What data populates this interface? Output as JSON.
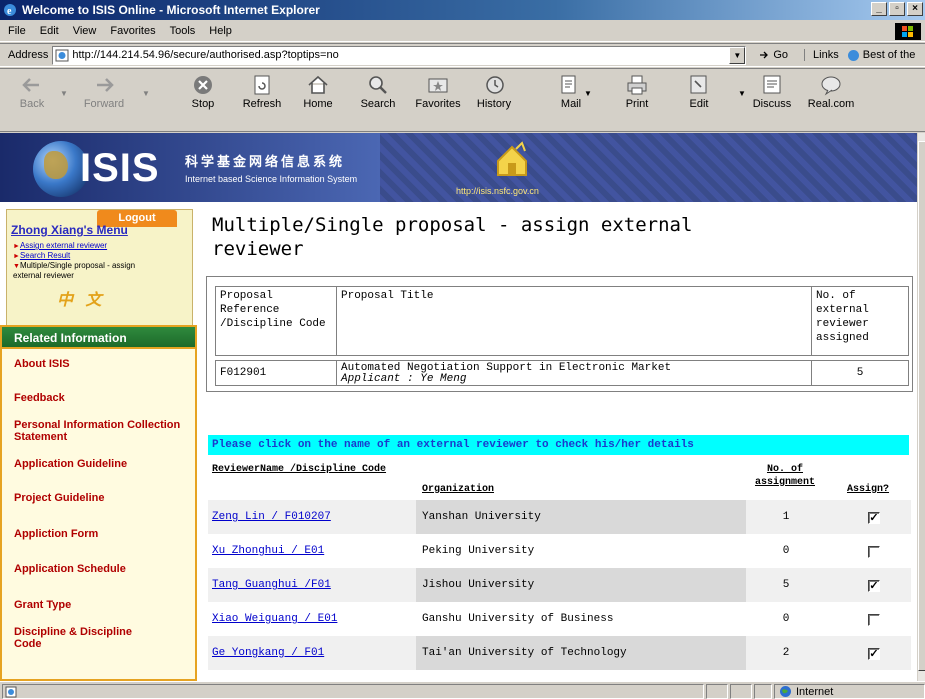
{
  "window": {
    "title": "Welcome to ISIS Online - Microsoft Internet Explorer",
    "min": "_",
    "max": "×",
    "close": "×"
  },
  "menubar": [
    "File",
    "Edit",
    "View",
    "Favorites",
    "Tools",
    "Help"
  ],
  "address": {
    "label": "Address",
    "url": "http://144.214.54.96/secure/authorised.asp?toptips=no",
    "go": "Go",
    "links": "Links",
    "best": "Best of the"
  },
  "toolbar": {
    "back": "Back",
    "forward": "Forward",
    "stop": "Stop",
    "refresh": "Refresh",
    "home": "Home",
    "search": "Search",
    "favorites": "Favorites",
    "history": "History",
    "mail": "Mail",
    "print": "Print",
    "edit": "Edit",
    "discuss": "Discuss",
    "realcom": "Real.com"
  },
  "banner": {
    "logo": "ISIS",
    "cn_title": "科学基金网络信息系统",
    "en_title": "Internet based Science Information System",
    "url": "http://isis.nsfc.gov.cn"
  },
  "sidebar": {
    "logout": "Logout",
    "menu_title": "Zhong Xiang's Menu",
    "links": [
      "Assign external reviewer",
      "Search Result",
      "Multiple/Single proposal - assign external reviewer"
    ],
    "cn_lang": "中 文",
    "related_title": "Related Information",
    "related": [
      "About ISIS",
      "Feedback",
      "Personal Information Collection Statement",
      "Application Guideline",
      "Project Guideline",
      "Appliction Form",
      "Application Schedule",
      "Grant Type",
      "Discipline & Discipline Code"
    ]
  },
  "main": {
    "title_line1": "Multiple/Single proposal - assign external",
    "title_line2": "reviewer",
    "proposal_table": {
      "headers": {
        "ref": "Proposal Reference /Discipline Code",
        "title": "Proposal Title",
        "count": "No. of external reviewer assigned"
      },
      "row": {
        "ref": "F012901",
        "title": "Automated Negotiation Support in Electronic Market",
        "applicant": "Applicant : Ye Meng",
        "count": "5"
      }
    },
    "notice": "Please click on the name of an external reviewer to check his/her details",
    "reviewer_headers": {
      "name": "ReviewerName /Discipline Code",
      "org": "Organization",
      "count": "No. of assignment",
      "assign": "Assign?"
    },
    "reviewers": [
      {
        "name": "Zeng Lin / F010207",
        "org": "Yanshan University",
        "count": "1",
        "checked": true
      },
      {
        "name": "Xu Zhonghui / E01",
        "org": "Peking University",
        "count": "0",
        "checked": false
      },
      {
        "name": "Tang Guanghui /F01",
        "org": "Jishou University",
        "count": "5",
        "checked": true
      },
      {
        "name": "Xiao Weiguang / E01",
        "org": "Ganshu University of Business",
        "count": "0",
        "checked": false
      },
      {
        "name": "Ge Yongkang / F01",
        "org": "Tai'an University of Technology",
        "count": "2",
        "checked": true
      }
    ]
  },
  "statusbar": {
    "zone": "Internet"
  },
  "colors": {
    "title_bar": "#0a246a",
    "notice_bg": "#00ffff",
    "link": "#0000cc",
    "related_link": "#b00000",
    "logout": "#f08a1c",
    "related_header": "#2f8a3d"
  }
}
